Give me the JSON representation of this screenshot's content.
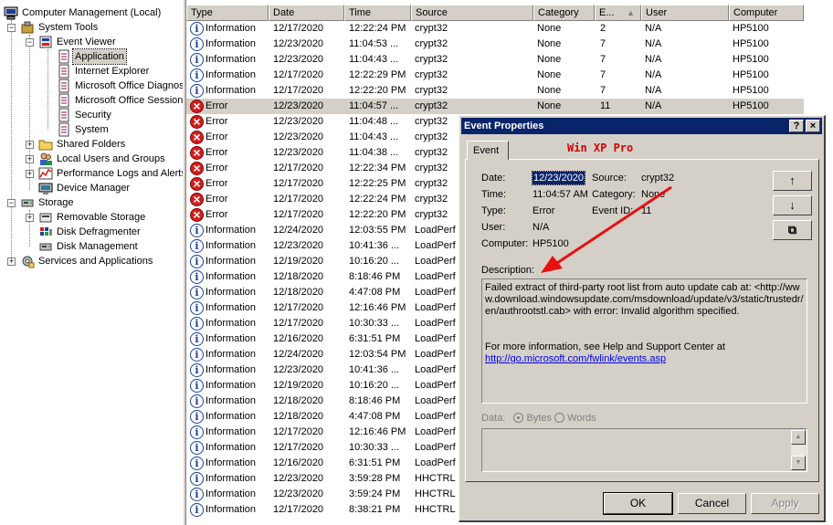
{
  "tree": {
    "root": "Computer Management (Local)",
    "system_tools": "System Tools",
    "event_viewer": "Event Viewer",
    "logs": [
      "Application",
      "Internet Explorer",
      "Microsoft Office Diagnos",
      "Microsoft Office Session",
      "Security",
      "System"
    ],
    "shared_folders": "Shared Folders",
    "local_users": "Local Users and Groups",
    "perf_logs": "Performance Logs and Alerts",
    "device_manager": "Device Manager",
    "storage": "Storage",
    "removable_storage": "Removable Storage",
    "disk_defrag": "Disk Defragmenter",
    "disk_mgmt": "Disk Management",
    "services_apps": "Services and Applications"
  },
  "list": {
    "headers": [
      "Type",
      "Date",
      "Time",
      "Source",
      "Category",
      "E...",
      "User",
      "Computer"
    ],
    "rows": [
      {
        "type": "Information",
        "icon": "info",
        "date": "12/17/2020",
        "time": "12:22:24 PM",
        "source": "crypt32",
        "category": "None",
        "event": "2",
        "user": "N/A",
        "computer": "HP5100"
      },
      {
        "type": "Information",
        "icon": "info",
        "date": "12/23/2020",
        "time": "11:04:53 ...",
        "source": "crypt32",
        "category": "None",
        "event": "7",
        "user": "N/A",
        "computer": "HP5100"
      },
      {
        "type": "Information",
        "icon": "info",
        "date": "12/23/2020",
        "time": "11:04:43 ...",
        "source": "crypt32",
        "category": "None",
        "event": "7",
        "user": "N/A",
        "computer": "HP5100"
      },
      {
        "type": "Information",
        "icon": "info",
        "date": "12/17/2020",
        "time": "12:22:29 PM",
        "source": "crypt32",
        "category": "None",
        "event": "7",
        "user": "N/A",
        "computer": "HP5100"
      },
      {
        "type": "Information",
        "icon": "info",
        "date": "12/17/2020",
        "time": "12:22:20 PM",
        "source": "crypt32",
        "category": "None",
        "event": "7",
        "user": "N/A",
        "computer": "HP5100"
      },
      {
        "type": "Error",
        "icon": "error",
        "date": "12/23/2020",
        "time": "11:04:57 ...",
        "source": "crypt32",
        "category": "None",
        "event": "11",
        "user": "N/A",
        "computer": "HP5100",
        "selected": true
      },
      {
        "type": "Error",
        "icon": "error",
        "date": "12/23/2020",
        "time": "11:04:48 ...",
        "source": "crypt32",
        "category": "",
        "event": "",
        "user": "",
        "computer": ""
      },
      {
        "type": "Error",
        "icon": "error",
        "date": "12/23/2020",
        "time": "11:04:43 ...",
        "source": "crypt32",
        "category": "",
        "event": "",
        "user": "",
        "computer": ""
      },
      {
        "type": "Error",
        "icon": "error",
        "date": "12/23/2020",
        "time": "11:04:38 ...",
        "source": "crypt32",
        "category": "",
        "event": "",
        "user": "",
        "computer": ""
      },
      {
        "type": "Error",
        "icon": "error",
        "date": "12/17/2020",
        "time": "12:22:34 PM",
        "source": "crypt32",
        "category": "",
        "event": "",
        "user": "",
        "computer": ""
      },
      {
        "type": "Error",
        "icon": "error",
        "date": "12/17/2020",
        "time": "12:22:25 PM",
        "source": "crypt32",
        "category": "",
        "event": "",
        "user": "",
        "computer": ""
      },
      {
        "type": "Error",
        "icon": "error",
        "date": "12/17/2020",
        "time": "12:22:24 PM",
        "source": "crypt32",
        "category": "",
        "event": "",
        "user": "",
        "computer": ""
      },
      {
        "type": "Error",
        "icon": "error",
        "date": "12/17/2020",
        "time": "12:22:20 PM",
        "source": "crypt32",
        "category": "",
        "event": "",
        "user": "",
        "computer": ""
      },
      {
        "type": "Information",
        "icon": "info",
        "date": "12/24/2020",
        "time": "12:03:55 PM",
        "source": "LoadPerf",
        "category": "",
        "event": "",
        "user": "",
        "computer": ""
      },
      {
        "type": "Information",
        "icon": "info",
        "date": "12/23/2020",
        "time": "10:41:36 ...",
        "source": "LoadPerf",
        "category": "",
        "event": "",
        "user": "",
        "computer": ""
      },
      {
        "type": "Information",
        "icon": "info",
        "date": "12/19/2020",
        "time": "10:16:20 ...",
        "source": "LoadPerf",
        "category": "",
        "event": "",
        "user": "",
        "computer": ""
      },
      {
        "type": "Information",
        "icon": "info",
        "date": "12/18/2020",
        "time": "8:18:46 PM",
        "source": "LoadPerf",
        "category": "",
        "event": "",
        "user": "",
        "computer": ""
      },
      {
        "type": "Information",
        "icon": "info",
        "date": "12/18/2020",
        "time": "4:47:08 PM",
        "source": "LoadPerf",
        "category": "",
        "event": "",
        "user": "",
        "computer": ""
      },
      {
        "type": "Information",
        "icon": "info",
        "date": "12/17/2020",
        "time": "12:16:46 PM",
        "source": "LoadPerf",
        "category": "",
        "event": "",
        "user": "",
        "computer": ""
      },
      {
        "type": "Information",
        "icon": "info",
        "date": "12/17/2020",
        "time": "10:30:33 ...",
        "source": "LoadPerf",
        "category": "",
        "event": "",
        "user": "",
        "computer": ""
      },
      {
        "type": "Information",
        "icon": "info",
        "date": "12/16/2020",
        "time": "6:31:51 PM",
        "source": "LoadPerf",
        "category": "",
        "event": "",
        "user": "",
        "computer": ""
      },
      {
        "type": "Information",
        "icon": "info",
        "date": "12/24/2020",
        "time": "12:03:54 PM",
        "source": "LoadPerf",
        "category": "",
        "event": "",
        "user": "",
        "computer": ""
      },
      {
        "type": "Information",
        "icon": "info",
        "date": "12/23/2020",
        "time": "10:41:36 ...",
        "source": "LoadPerf",
        "category": "",
        "event": "",
        "user": "",
        "computer": ""
      },
      {
        "type": "Information",
        "icon": "info",
        "date": "12/19/2020",
        "time": "10:16:20 ...",
        "source": "LoadPerf",
        "category": "",
        "event": "",
        "user": "",
        "computer": ""
      },
      {
        "type": "Information",
        "icon": "info",
        "date": "12/18/2020",
        "time": "8:18:46 PM",
        "source": "LoadPerf",
        "category": "",
        "event": "",
        "user": "",
        "computer": ""
      },
      {
        "type": "Information",
        "icon": "info",
        "date": "12/18/2020",
        "time": "4:47:08 PM",
        "source": "LoadPerf",
        "category": "",
        "event": "",
        "user": "",
        "computer": ""
      },
      {
        "type": "Information",
        "icon": "info",
        "date": "12/17/2020",
        "time": "12:16:46 PM",
        "source": "LoadPerf",
        "category": "",
        "event": "",
        "user": "",
        "computer": ""
      },
      {
        "type": "Information",
        "icon": "info",
        "date": "12/17/2020",
        "time": "10:30:33 ...",
        "source": "LoadPerf",
        "category": "",
        "event": "",
        "user": "",
        "computer": ""
      },
      {
        "type": "Information",
        "icon": "info",
        "date": "12/16/2020",
        "time": "6:31:51 PM",
        "source": "LoadPerf",
        "category": "",
        "event": "",
        "user": "",
        "computer": ""
      },
      {
        "type": "Information",
        "icon": "info",
        "date": "12/23/2020",
        "time": "3:59:28 PM",
        "source": "HHCTRL",
        "category": "",
        "event": "",
        "user": "",
        "computer": ""
      },
      {
        "type": "Information",
        "icon": "info",
        "date": "12/23/2020",
        "time": "3:59:24 PM",
        "source": "HHCTRL",
        "category": "",
        "event": "",
        "user": "",
        "computer": ""
      },
      {
        "type": "Information",
        "icon": "info",
        "date": "12/17/2020",
        "time": "8:38:21 PM",
        "source": "HHCTRL",
        "category": "",
        "event": "",
        "user": "",
        "computer": ""
      }
    ]
  },
  "dialog": {
    "title": "Event Properties",
    "help": "?",
    "close": "×",
    "tab": "Event",
    "watermark": "Win XP Pro",
    "labels": {
      "date": "Date:",
      "source": "Source:",
      "time": "Time:",
      "category": "Category:",
      "type": "Type:",
      "event_id": "Event ID:",
      "user": "User:",
      "computer": "Computer:",
      "description": "Description:",
      "data": "Data:",
      "bytes": "Bytes",
      "words": "Words"
    },
    "values": {
      "date": "12/23/2020",
      "source": "crypt32",
      "time": "11:04:57 AM",
      "category": "None",
      "type": "Error",
      "event_id": "11",
      "user": "N/A",
      "computer": "HP5100"
    },
    "description": {
      "text": "Failed extract of third-party root list from auto update cab at: <http://www.download.windowsupdate.com/msdownload/update/v3/static/trustedr/en/authrootstl.cab> with error: Invalid algorithm specified.",
      "more": "For more information, see Help and Support Center at",
      "link": "http://go.microsoft.com/fwlink/events.asp"
    },
    "buttons": {
      "up": "↑",
      "down": "↓",
      "copy": "⧉",
      "ok": "OK",
      "cancel": "Cancel",
      "apply": "Apply"
    }
  },
  "colors": {
    "titlebar": "#0a246a",
    "annotation_red": "#e81010",
    "error_icon": "#d11f1f",
    "info_icon": "#1c3f9a"
  }
}
